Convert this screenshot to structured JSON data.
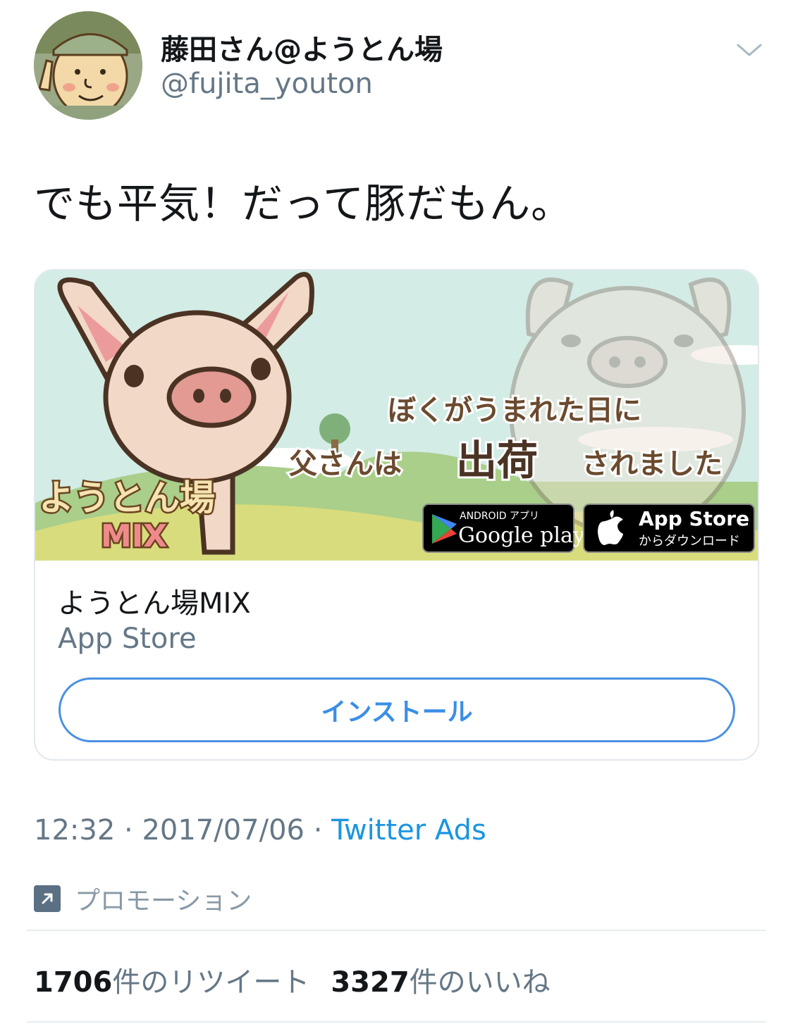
{
  "tweet": {
    "author_name": "藤田さん@ようとん場",
    "author_handle": "@fujita_youton",
    "text": "でも平気！だって豚だもん。",
    "time": "12:32",
    "separator": " · ",
    "date": "2017/07/06",
    "source": "Twitter Ads",
    "promoted_label": "プロモーション",
    "retweet_count": "1706",
    "retweet_label": "件のリツイート",
    "like_count": "3327",
    "like_label": "件のいいね"
  },
  "card": {
    "banner": {
      "headline_line1": "ぼくがうまれた日に",
      "headline_line2_a": "父さんは",
      "headline_line2_b": "出荷",
      "headline_line2_c": "されました",
      "logo_text": "ようとん場",
      "logo_mix": "MIX",
      "google_small": "ANDROID アプリ",
      "google_big": "Google play",
      "apple_big": "App Store",
      "apple_small": "からダウンロード"
    },
    "title": "ようとん場MIX",
    "store": "App Store",
    "install_label": "インストール"
  },
  "icons": [
    "avatar",
    "chevron-down-icon",
    "promoted-icon",
    "google-play-icon",
    "apple-icon"
  ],
  "colors": {
    "link": "#1b95e0",
    "install_border": "#4a90e2",
    "secondary_text": "#657786",
    "banner_sky": "#cfe9e3"
  }
}
